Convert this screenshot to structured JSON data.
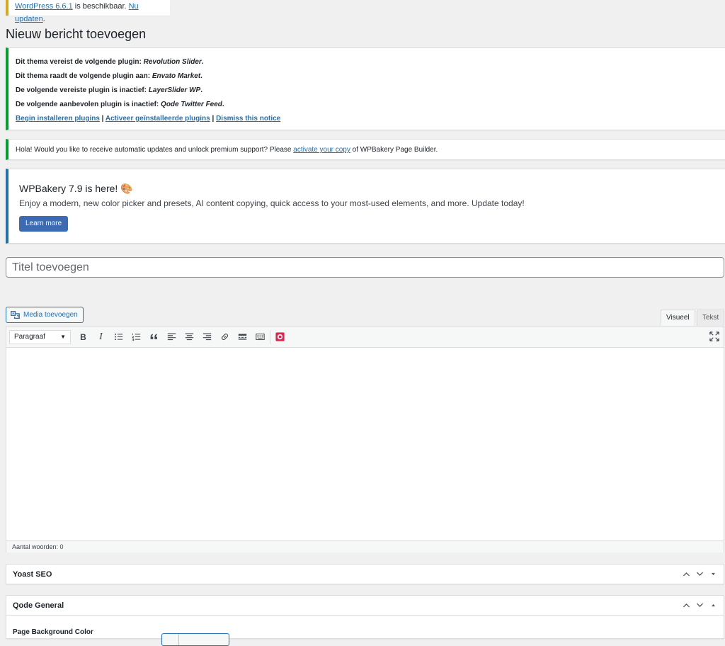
{
  "update_nag": {
    "version_link": "WordPress 6.6.1",
    "text": " is beschikbaar. ",
    "update_link": "Nu updaten",
    "end": "."
  },
  "page_title": "Nieuw bericht toevoegen",
  "tgmpa_notice": {
    "line1_prefix": "Dit thema vereist de volgende plugin: ",
    "line1_plugin": "Revolution Slider",
    "line2_prefix": "Dit thema raadt de volgende plugin aan: ",
    "line2_plugin": "Envato Market",
    "line3_prefix": "De volgende vereiste plugin is inactief: ",
    "line3_plugin": "LayerSlider WP",
    "line4_prefix": "De volgende aanbevolen plugin is inactief: ",
    "line4_plugin": "Qode Twitter Feed",
    "dot": ".",
    "link_install": "Begin installeren plugins",
    "link_activate": "Activeer geïnstalleerde plugins",
    "link_dismiss": "Dismiss this notice",
    "separator": " | "
  },
  "vc_notice": {
    "text_before": "Hola! Would you like to receive automatic updates and unlock premium support? Please ",
    "link": "activate your copy",
    "text_after": " of WPBakery Page Builder."
  },
  "wpb_notice": {
    "title": "WPBakery 7.9 is here! 🎨",
    "text": "Enjoy a modern, new color picker and presets, AI content copying, quick access to your most-used elements, and more. Update today!",
    "button": "Learn more"
  },
  "title_input": {
    "placeholder": "Titel toevoegen",
    "value": ""
  },
  "media_button": "Media toevoegen",
  "tabs": {
    "visual": "Visueel",
    "text": "Tekst"
  },
  "toolbar": {
    "format": "Paragraaf",
    "bold": "B",
    "italic": "I"
  },
  "status": {
    "word_count": "Aantal woorden: 0"
  },
  "yoast": {
    "title": "Yoast SEO"
  },
  "qode": {
    "title": "Qode General",
    "field_label": "Page Background Color"
  },
  "colors": {
    "accent": "#2271b1",
    "success": "#00a32a",
    "warning": "#dba617",
    "wpb_blue": "#3d6bb3"
  }
}
